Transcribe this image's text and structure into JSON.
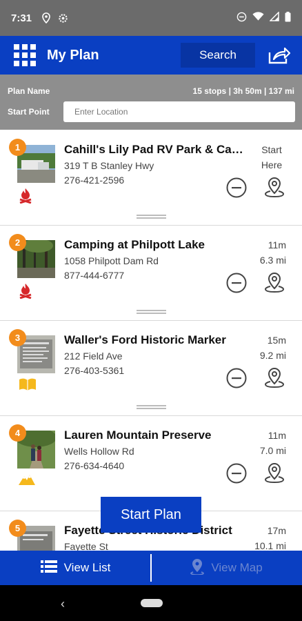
{
  "status_bar": {
    "time": "7:31"
  },
  "header": {
    "title": "My Plan",
    "search_label": "Search"
  },
  "plan": {
    "name_label": "Plan Name",
    "stats": "15 stops | 3h 50m | 137 mi",
    "start_label": "Start Point",
    "start_placeholder": "Enter Location"
  },
  "stops": [
    {
      "num": "1",
      "name": "Cahill's Lily Pad RV Park & Campground",
      "address": "319 T B Stanley Hwy",
      "phone": "276-421-2596",
      "time": "Start",
      "dist": "Here",
      "category_icon": "campfire-icon",
      "thumb": "rv-park-photo"
    },
    {
      "num": "2",
      "name": "Camping at Philpott Lake",
      "address": "1058 Philpott Dam Rd",
      "phone": "877-444-6777",
      "time": "11m",
      "dist": "6.3 mi",
      "category_icon": "campfire-icon",
      "thumb": "forest-photo"
    },
    {
      "num": "3",
      "name": "Waller's Ford Historic Marker",
      "address": "212 Field Ave",
      "phone": "276-403-5361",
      "time": "15m",
      "dist": "9.2 mi",
      "category_icon": "book-icon",
      "thumb": "marker-sign-photo"
    },
    {
      "num": "4",
      "name": "Lauren Mountain Preserve",
      "address": "Wells Hollow Rd",
      "phone": "276-634-4640",
      "time": "11m",
      "dist": "7.0 mi",
      "category_icon": "mountain-icon",
      "thumb": "hikers-photo"
    },
    {
      "num": "5",
      "name": "Fayette Street Historic District",
      "address": "Fayette St",
      "phone": "",
      "time": "17m",
      "dist": "10.1 mi",
      "category_icon": "book-icon",
      "thumb": "street-sign-photo"
    }
  ],
  "start_plan_label": "Start Plan",
  "bottom_nav": {
    "view_list": "View List",
    "view_map": "View Map"
  },
  "colors": {
    "brand_blue": "#0a3fc2",
    "badge_orange": "#f28c1c",
    "camp_red": "#d6282b",
    "category_gold": "#f5b81c",
    "plan_bar_gray": "#8e8e8e"
  }
}
